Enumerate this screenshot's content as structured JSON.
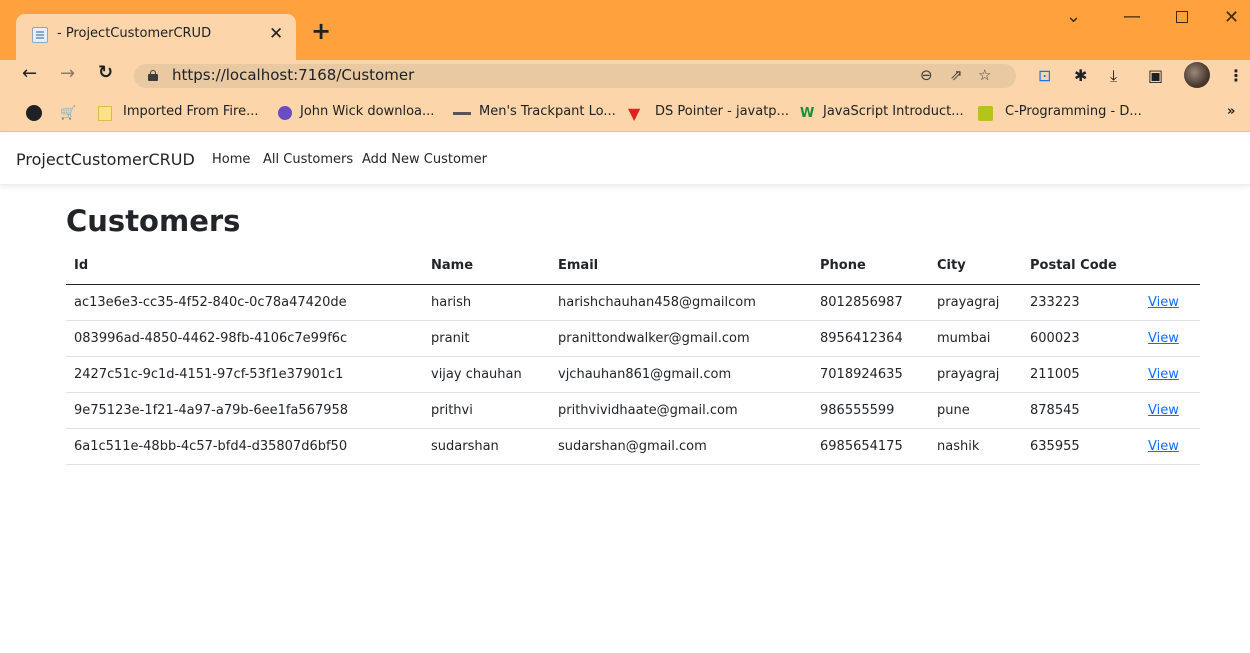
{
  "browser": {
    "tab_title": "- ProjectCustomerCRUD",
    "url": "https://localhost:7168/Customer",
    "bookmarks": [
      {
        "label": "Imported From Fire...",
        "icon": "folder-icon"
      },
      {
        "label": "John Wick downloa...",
        "icon": "site-icon"
      },
      {
        "label": "Men's Trackpant Lo...",
        "icon": "site-icon"
      },
      {
        "label": "DS Pointer - javatp...",
        "icon": "site-icon"
      },
      {
        "label": "JavaScript Introduct...",
        "icon": "site-icon"
      },
      {
        "label": "C-Programming - D...",
        "icon": "site-icon"
      }
    ]
  },
  "app": {
    "brand": "ProjectCustomerCRUD",
    "nav": [
      "Home",
      "All Customers",
      "Add New Customer"
    ],
    "title": "Customers",
    "columns": [
      "Id",
      "Name",
      "Email",
      "Phone",
      "City",
      "Postal Code"
    ],
    "view_label": "View",
    "link_color": "#0d6efd",
    "rows": [
      {
        "id": "ac13e6e3-cc35-4f52-840c-0c78a47420de",
        "name": "harish",
        "email": "harishchauhan458@gmailcom",
        "phone": "8012856987",
        "city": "prayagraj",
        "postal": "233223"
      },
      {
        "id": "083996ad-4850-4462-98fb-4106c7e99f6c",
        "name": "pranit",
        "email": "pranittondwalker@gmail.com",
        "phone": "8956412364",
        "city": "mumbai",
        "postal": "600023"
      },
      {
        "id": "2427c51c-9c1d-4151-97cf-53f1e37901c1",
        "name": "vijay chauhan",
        "email": "vjchauhan861@gmail.com",
        "phone": "7018924635",
        "city": "prayagraj",
        "postal": "211005"
      },
      {
        "id": "9e75123e-1f21-4a97-a79b-6ee1fa567958",
        "name": "prithvi",
        "email": "prithvividhaate@gmail.com",
        "phone": "986555599",
        "city": "pune",
        "postal": "878545"
      },
      {
        "id": "6a1c511e-48bb-4c57-bfd4-d35807d6bf50",
        "name": "sudarshan",
        "email": "sudarshan@gmail.com",
        "phone": "6985654175",
        "city": "nashik",
        "postal": "635955"
      }
    ]
  }
}
